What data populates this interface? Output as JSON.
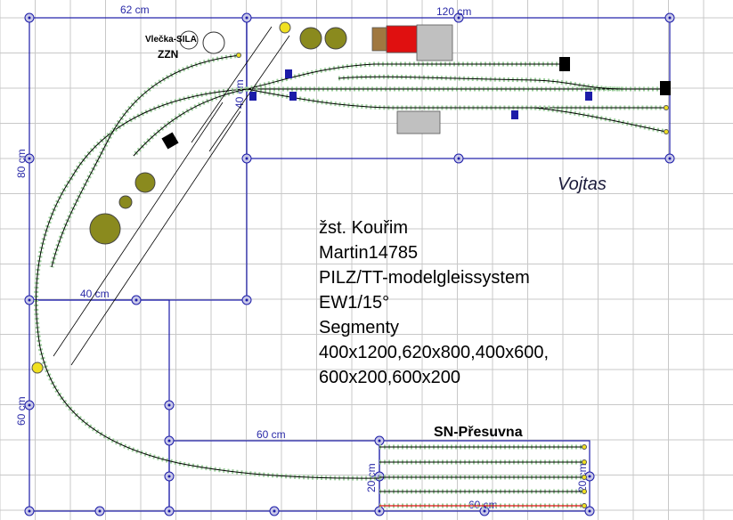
{
  "dimensions": {
    "top_left": "62 cm",
    "top_right": "120 cm",
    "left_side": "80 cm",
    "middle": "40 cm",
    "mid_vertical": "40 cm",
    "lower_left": "60 cm",
    "bottom": "60 cm",
    "bottom_right": "60 cm",
    "right_small": "20 cm",
    "left_small": "20 cm"
  },
  "labels": {
    "siding": "Vlečka-SILA",
    "zzn": "ZZN",
    "owner": "Vojtas",
    "transfer": "SN-Přesuvna"
  },
  "info_lines": [
    "žst. Kouřim",
    "Martin14785",
    "PILZ/TT-modelgleissystem",
    "EW1/15°",
    "Segmenty",
    "400x1200,620x800,400x600,",
    "600x200,600x200"
  ],
  "colors": {
    "grid": "#c8c8c8",
    "frame": "#1c1ca8",
    "track": "#000000",
    "ballast": "#9ccf9c",
    "silo": "#8a8a1e",
    "building_grey": "#c0c0c0",
    "building_red": "#e01010",
    "building_brown": "#a07840",
    "signal_yellow": "#f0e020"
  }
}
